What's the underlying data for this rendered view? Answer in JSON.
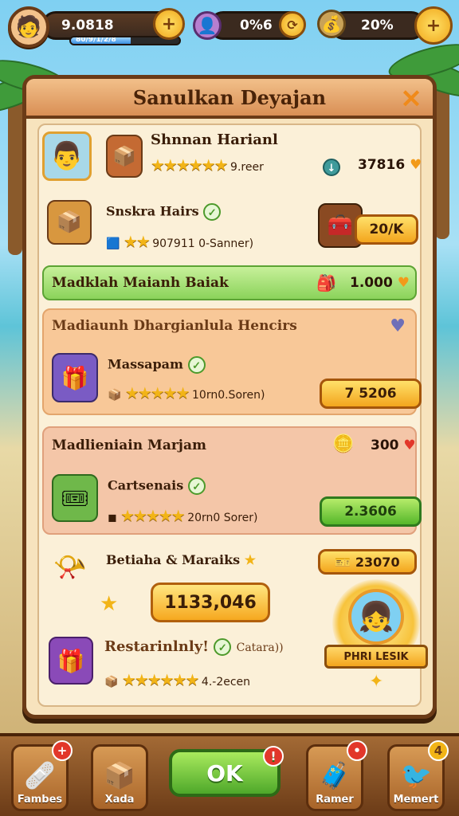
{
  "hud": {
    "level_value": "9.0818",
    "xp_bar_label": "80/9/1/2/8",
    "xp_fill": 0.55,
    "gems_value": "0%6",
    "coins_value": "20%",
    "plus_symbol": "+"
  },
  "panel": {
    "title": "Sanulkan Deyajan",
    "close_symbol": "✕"
  },
  "items": [
    {
      "title": "Shnnan Harianl",
      "meta": "9.reer",
      "value": "37816",
      "stars": "★★★★★★"
    },
    {
      "title": "Snskra Hairs",
      "meta": "907911   0-Sanner)",
      "button": "20/K",
      "stars": "★★"
    }
  ],
  "banner": {
    "title": "Madklah Maianh Baiak",
    "value": "1.000"
  },
  "section1": {
    "title": "Madiaunh Dhargianlula Hencirs",
    "item_title": "Massapam",
    "item_meta": "10rn0.Soren)",
    "button": "7   5206",
    "stars": "★★★★★"
  },
  "section2": {
    "title": "Madlieniain Marjam",
    "value": "300",
    "item_title": "Cartsenais",
    "item_meta": "20rn0 Sorer)",
    "button": "2.3606",
    "stars": "★★★★★"
  },
  "reward": {
    "title": "Betiaha & Maraiks",
    "value_badge": "23070",
    "amount": "1133,046",
    "premium_label": "PHRI LESIK"
  },
  "restock": {
    "title": "Restarinlnly!",
    "tag": "Catara))",
    "meta": "4.-2ecen",
    "stars": "★★★★★★"
  },
  "bottom_nav": [
    {
      "label": "Fambes",
      "notif": "+"
    },
    {
      "label": "Xada",
      "notif": ""
    },
    {
      "label": "Ramer",
      "notif": "•"
    },
    {
      "label": "Memert",
      "notif": "4"
    }
  ],
  "ok_label": "OK",
  "ok_notif": "!",
  "colors": {
    "panel_bg": "#f7e3bd",
    "accent_orange": "#f3a51d",
    "accent_green": "#55b72a",
    "border_brown": "#6b3b17"
  }
}
